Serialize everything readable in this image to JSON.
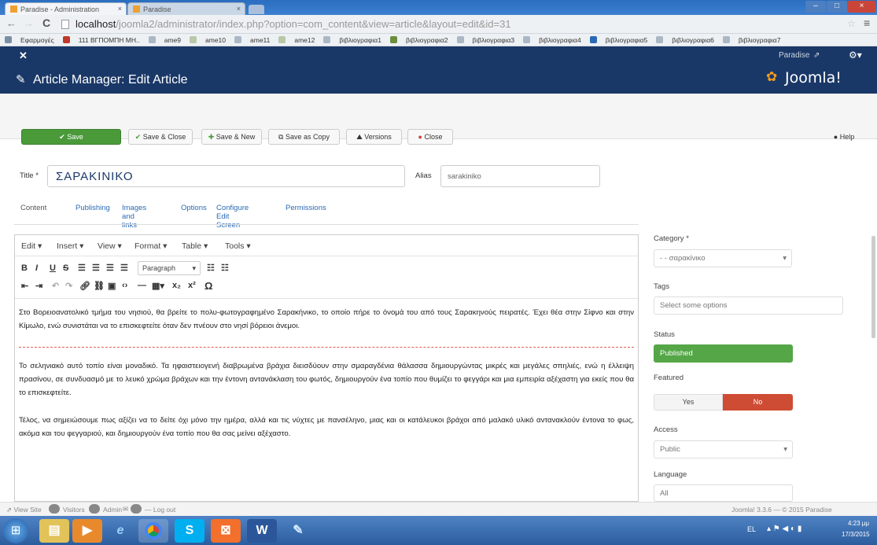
{
  "browser": {
    "tab1_title": "Paradise - Administration",
    "tab2_title": "Paradise",
    "url_host": "localhost",
    "url_path": "/joomla2/administrator/index.php?option=com_content&view=article&layout=edit&id=31",
    "bookmarks": [
      {
        "label": "Εφαρμογές",
        "color": "#7a8fa6"
      },
      {
        "label": "111 ΒΓΠΟΜΠΗ ΜΗ..",
        "color": "#c0392b"
      },
      {
        "label": "ame9",
        "color": "#aab8c6"
      },
      {
        "label": "ame10",
        "color": "#b8c8a8"
      },
      {
        "label": "ame11",
        "color": "#aab8c6"
      },
      {
        "label": "ame12",
        "color": "#b8c8a8"
      },
      {
        "label": "βιβλιογραφια1",
        "color": "#aab8c6"
      },
      {
        "label": "βιβλιογραφια2",
        "color": "#6b8e3d"
      },
      {
        "label": "βιβλιογραφια3",
        "color": "#aab8c6"
      },
      {
        "label": "βιβλιογραφια4",
        "color": "#aab8c6"
      },
      {
        "label": "βιβλιογραφια5",
        "color": "#2a6ab5"
      },
      {
        "label": "βιβλιογραφια6",
        "color": "#aab8c6"
      },
      {
        "label": "βιβλιογραφια7",
        "color": "#aab8c6"
      }
    ]
  },
  "joomla": {
    "site_name": "Paradise",
    "page_title": "Article Manager: Edit Article",
    "brand": "Joomla!",
    "toolbar": {
      "save": "Save",
      "save_close": "Save & Close",
      "save_new": "Save & New",
      "save_copy": "Save as Copy",
      "versions": "Versions",
      "close": "Close",
      "help": "Help"
    },
    "title_label": "Title",
    "title_value": "ΣΑΡΑΚΙΝΙΚΟ",
    "alias_label": "Alias",
    "alias_value": "sarakiniko",
    "tabs": [
      "Content",
      "Publishing",
      "Images and links",
      "Options",
      "Configure Edit Screen",
      "Permissions"
    ],
    "editor": {
      "menus": [
        "Edit",
        "Insert",
        "View",
        "Format",
        "Table",
        "Tools"
      ],
      "format_select": "Paragraph",
      "paragraphs": [
        "Στο Βορειοανατολικό τμήμα του νησιού, θα βρείτε το πολυ-φωτογραφημένο Σαρακήνικο, το οποίο πήρε το όνομά του από τους Σαρακηνούς πειρατές. Έχει θέα στην Σίφνο και στην Κίμωλο, ενώ συνιστάται να το επισκεφτείτε όταν δεν πνέουν στο νησί βόρειοι άνεμοι.",
        "Το σεληνιακό αυτό τοπίο είναι μοναδικό. Τα ηφαιστειογενή διαβρωμένα βράχια διεισδύουν στην σμαραγδένια θάλασσα δημιουργώντας μικρές και μεγάλες σπηλιές, ενώ η έλλειψη πρασίνου, σε συνδυασμό με το λευκό χρώμα βράχων και την έντονη αντανάκλαση του φωτός, δημιουργούν ένα τοπίο που θυμίζει το φεγγάρι και μια εμπειρία αξέχαστη για εκείς που θα το επισκεφτείτε.",
        "Τέλος, να σημειώσουμε πως αξίζει να το δείτε όχι μόνο την ημέρα, αλλά και τις νύχτες με πανσέληνο, μιας και οι κατάλευκοι βράχοι από μαλακό υλικό αντανακλούν έντονα το φως, ακόμα και του φεγγαριού, και δημιουργούν ένα τοπίο που θα σας μείνει αξέχαστο."
      ]
    },
    "sidebar": {
      "category_label": "Category",
      "category_value": "- - σαρακίνικο",
      "tags_label": "Tags",
      "tags_placeholder": "Select some options",
      "status_label": "Status",
      "status_value": "Published",
      "featured_label": "Featured",
      "featured_yes": "Yes",
      "featured_no": "No",
      "access_label": "Access",
      "access_value": "Public",
      "language_label": "Language",
      "language_value": "All"
    },
    "statusbar": {
      "view_site": "View Site",
      "visitors": "Visitors",
      "admin": "Admin",
      "logout": "Log out",
      "copyright": "Joomla! 3.3.6 — © 2015 Paradise"
    }
  },
  "taskbar": {
    "lang": "EL",
    "time": "4:23 μμ",
    "date": "17/3/2015"
  },
  "colors": {
    "joomla_navy": "#1a3867",
    "save_green": "#4a9a3a",
    "published_green": "#54a647",
    "no_red": "#cf4c34",
    "link_blue": "#2a6ab5"
  }
}
